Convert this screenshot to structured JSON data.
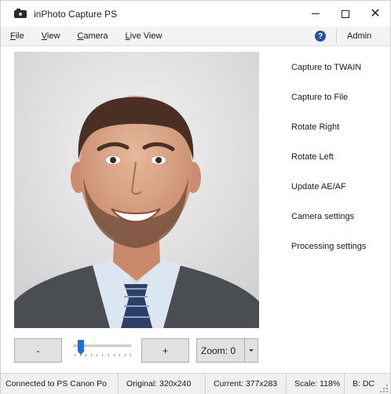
{
  "window": {
    "title": "inPhoto Capture PS",
    "controls": {
      "minimize": "minimize",
      "maximize": "maximize",
      "close": "✕"
    }
  },
  "menu": {
    "items": [
      {
        "label": "File",
        "accel": "F",
        "rest": "ile"
      },
      {
        "label": "View",
        "accel": "V",
        "rest": "iew"
      },
      {
        "label": "Camera",
        "accel": "C",
        "rest": "amera"
      },
      {
        "label": "Live View",
        "accel": "L",
        "rest": "ive View"
      }
    ],
    "help_glyph": "?",
    "admin_label": "Admin"
  },
  "actions": [
    "Capture to TWAIN",
    "Capture to File",
    "Rotate Right",
    "Rotate Left",
    "Update AE/AF",
    "Camera settings",
    "Processing settings"
  ],
  "controls": {
    "minus_label": "-",
    "plus_label": "+",
    "slider_value": 0.08,
    "zoom_label": "Zoom: 0"
  },
  "status": {
    "connection": "Connected to PS Canon Po",
    "original": "Original: 320x240",
    "current": "Current: 377x283",
    "scale": "Scale: 118%",
    "bd": "B: DC"
  },
  "colors": {
    "accent": "#1e6fd6",
    "help": "#2a4f9b"
  },
  "icons": {
    "app": "camera-icon",
    "help": "help-icon",
    "dropdown": "chevron-down-icon"
  }
}
